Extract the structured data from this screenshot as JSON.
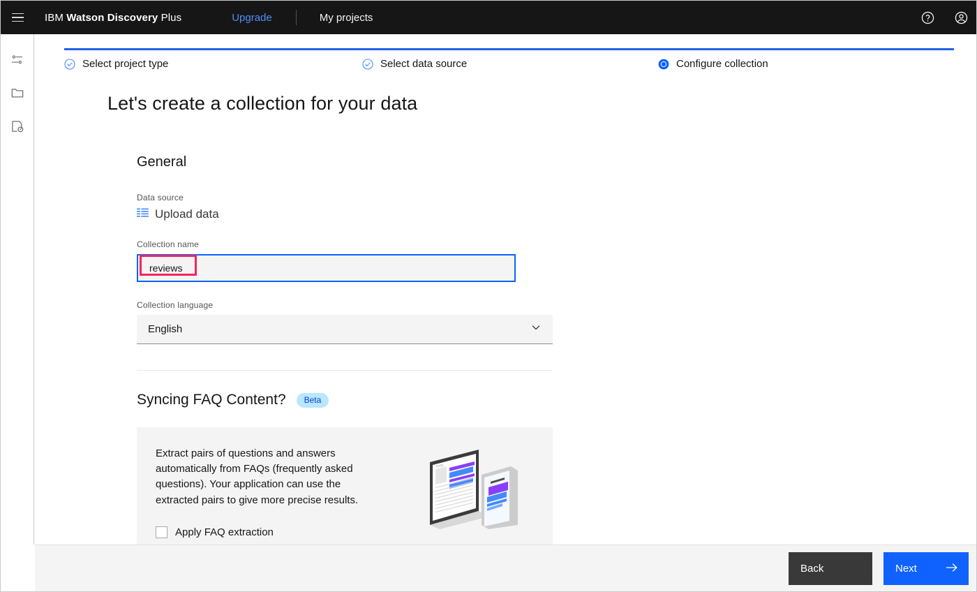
{
  "header": {
    "menu_icon": "hamburger-menu-icon",
    "brand_prefix": "IBM ",
    "brand_bold": "Watson Discovery",
    "brand_suffix": " Plus",
    "upgrade_label": "Upgrade",
    "projects_label": "My projects",
    "help_icon": "help-circle-icon",
    "account_icon": "user-avatar-icon"
  },
  "rail": {
    "items": [
      {
        "icon": "settings-list-icon",
        "name": "manage-settings"
      },
      {
        "icon": "folder-icon",
        "name": "projects-folder"
      },
      {
        "icon": "document-collection-icon",
        "name": "collections"
      }
    ]
  },
  "steps": [
    {
      "label": "Select project type",
      "state": "complete",
      "icon": "check-circle-icon"
    },
    {
      "label": "Select data source",
      "state": "complete",
      "icon": "check-circle-icon"
    },
    {
      "label": "Configure collection",
      "state": "current",
      "icon": "radio-filled-icon"
    }
  ],
  "page": {
    "title": "Let's create a collection for your data"
  },
  "general": {
    "section_title": "General",
    "data_source_label": "Data source",
    "data_source_value": "Upload data",
    "data_source_icon": "data-table-icon",
    "collection_name_label": "Collection name",
    "collection_name_value": "reviews",
    "collection_name_placeholder": "",
    "collection_language_label": "Collection language",
    "collection_language_value": "English",
    "chevron_icon": "chevron-down-icon"
  },
  "faq": {
    "title": "Syncing FAQ Content?",
    "badge": "Beta",
    "description": "Extract pairs of questions and answers automatically from FAQs (frequently asked questions). Your application can use the extracted pairs to give more precise results.",
    "checkbox_label": "Apply FAQ extraction",
    "illustration": "faq-laptop-tablet-illustration"
  },
  "footer": {
    "back_label": "Back",
    "next_label": "Next",
    "next_icon": "arrow-right-icon"
  },
  "colors": {
    "brand_blue": "#0f62fe",
    "header_black": "#161616",
    "annotation_pink": "#f5245e",
    "beta_bg": "#bae6ff",
    "beta_text": "#0043ce",
    "field_bg": "#f4f4f4"
  }
}
